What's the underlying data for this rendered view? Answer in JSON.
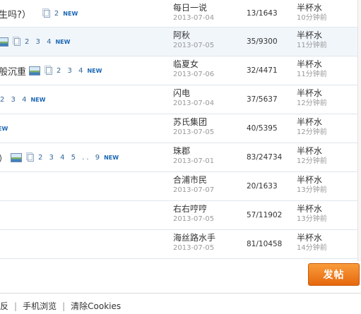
{
  "threads": [
    {
      "title": "生吗?）",
      "has_image": false,
      "pages": "2",
      "new": "NEW",
      "author": "每日一说",
      "date": "2013-07-04",
      "stats": "13/1643",
      "last_poster": "半杯水",
      "last_time": "10分钟前"
    },
    {
      "title": "",
      "has_image": true,
      "pages": "2 3 4",
      "new": "NEW",
      "author": "阿秋",
      "date": "2013-07-05",
      "stats": "35/9300",
      "last_poster": "半杯水",
      "last_time": "11分钟前"
    },
    {
      "title": "般沉重",
      "has_image": true,
      "pages": "2 3 4",
      "new": "NEW",
      "author": "临夏女",
      "date": "2013-07-06",
      "stats": "32/4471",
      "last_poster": "半杯水",
      "last_time": "11分钟前"
    },
    {
      "title": "",
      "has_image": false,
      "pages": "2 3 4",
      "new": "NEW",
      "author": "闪电",
      "date": "2013-07-04",
      "stats": "37/5637",
      "last_poster": "半杯水",
      "last_time": "12分钟前"
    },
    {
      "title": "",
      "has_image": false,
      "pages": "",
      "new": "EW",
      "author": "苏氏集团",
      "date": "2013-07-05",
      "stats": "40/5395",
      "last_poster": "半杯水",
      "last_time": "12分钟前"
    },
    {
      "title": "）",
      "has_image": true,
      "pages": "2 3 4 5 .. 9",
      "new": "NEW",
      "author": "珠郡",
      "date": "2013-07-01",
      "stats": "83/24734",
      "last_poster": "半杯水",
      "last_time": "12分钟前"
    },
    {
      "title": "",
      "has_image": false,
      "pages": "",
      "new": "",
      "author": "合浦市民",
      "date": "2013-07-07",
      "stats": "20/1633",
      "last_poster": "半杯水",
      "last_time": "13分钟前"
    },
    {
      "title": "",
      "has_image": false,
      "pages": "",
      "new": "",
      "author": "右右哼哼",
      "date": "2013-07-05",
      "stats": "57/11902",
      "last_poster": "半杯水",
      "last_time": "13分钟前"
    },
    {
      "title": "",
      "has_image": false,
      "pages": "",
      "new": "",
      "author": "海丝路水手",
      "date": "2013-07-05",
      "stats": "81/10458",
      "last_poster": "半杯水",
      "last_time": "14分钟前"
    }
  ],
  "post_button": "发帖",
  "footer": {
    "link1": "反",
    "link2": "手机浏览",
    "link3": "清除Cookies"
  }
}
